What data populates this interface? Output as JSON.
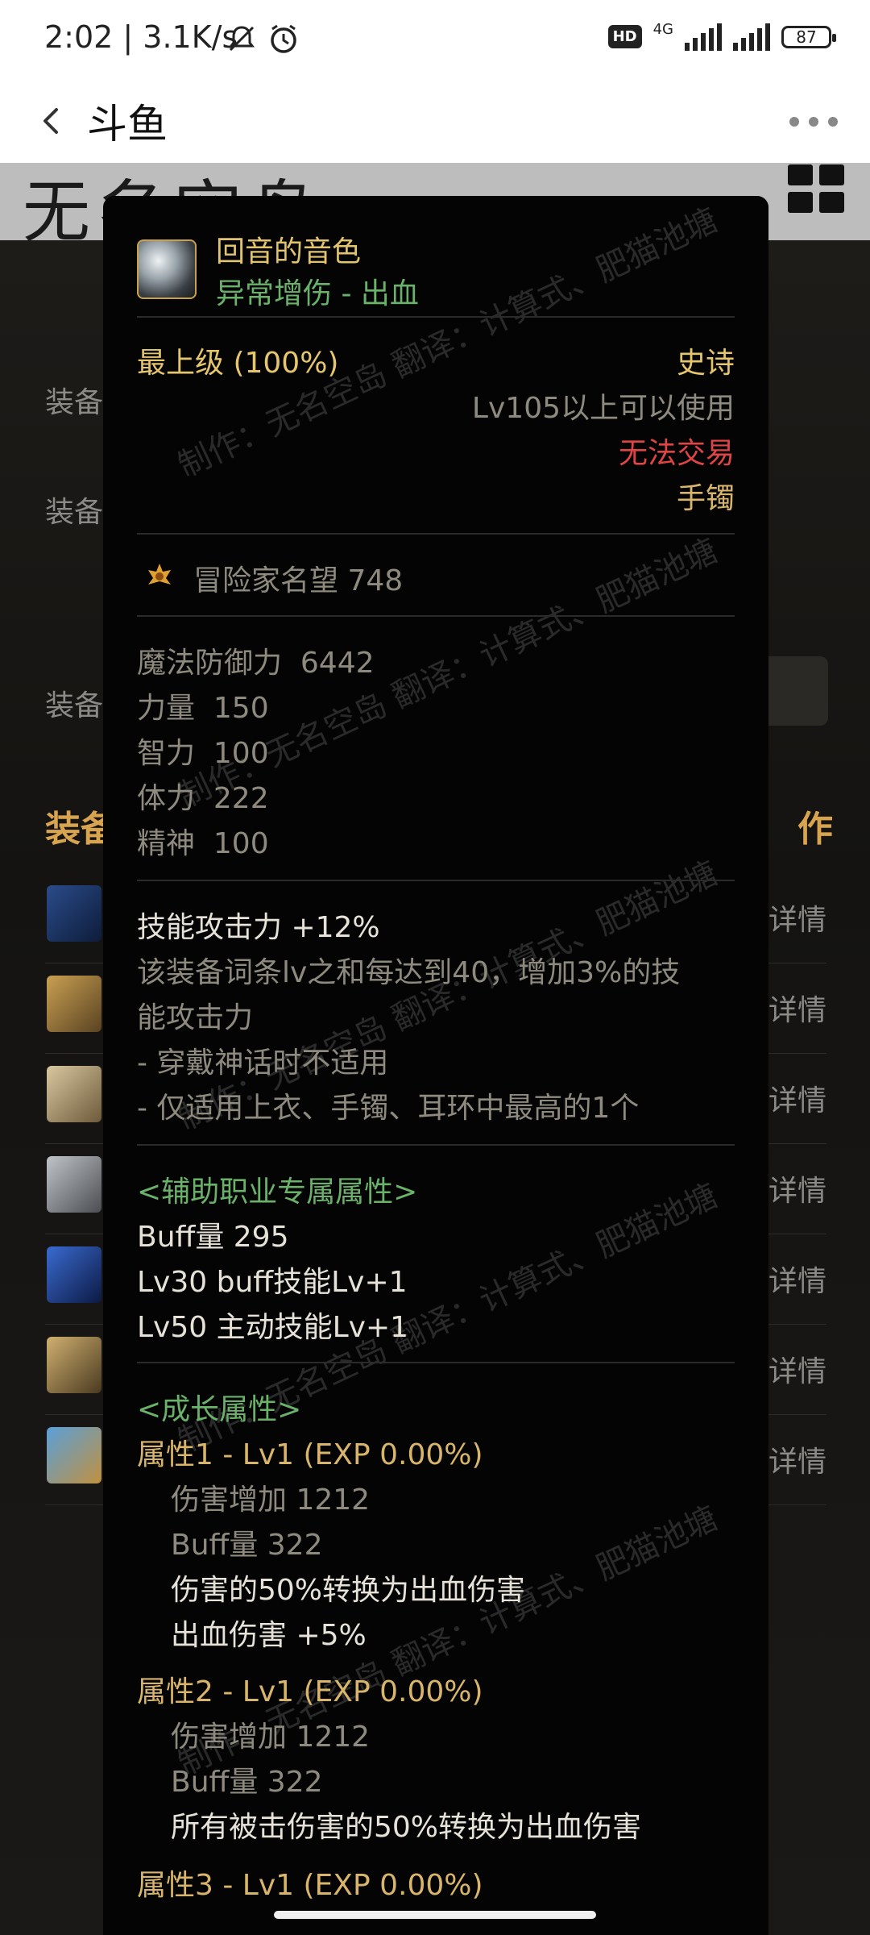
{
  "status_bar": {
    "time": "2:02 | 3.1K/s",
    "hd": "HD",
    "network": "4G",
    "battery": "87"
  },
  "app_bar": {
    "title": "斗鱼"
  },
  "background": {
    "banner_text": "无名空岛",
    "labels": [
      "装备",
      "装备",
      "装备"
    ],
    "heading": "装备",
    "heading_right": "作",
    "row_detail": "详情"
  },
  "tooltip": {
    "name": "回音的音色",
    "subtitle": "异常增伤 - 出血",
    "grade": "最上级 (100%)",
    "rarity": "史诗",
    "level_req": "Lv105以上可以使用",
    "trade": "无法交易",
    "slot": "手镯",
    "fame": "冒险家名望 748",
    "stats": [
      {
        "label": "魔法防御力",
        "value": "6442"
      },
      {
        "label": "力量",
        "value": "150"
      },
      {
        "label": "智力",
        "value": "100"
      },
      {
        "label": "体力",
        "value": "222"
      },
      {
        "label": "精神",
        "value": "100"
      }
    ],
    "skill_atk": "技能攻击力  +12%",
    "skill_desc_1": "该装备词条lv之和每达到40，增加3%的技",
    "skill_desc_2": "能攻击力",
    "skill_note_1": "- 穿戴神话时不适用",
    "skill_note_2": "- 仅适用上衣、手镯、耳环中最高的1个",
    "support_header": "<辅助职业专属属性>",
    "support_lines": [
      "Buff量  295",
      "Lv30 buff技能Lv+1",
      "Lv50 主动技能Lv+1"
    ],
    "growth_header": "<成长属性>",
    "attr1_title": "属性1 - Lv1 (EXP 0.00%)",
    "attr1_stat1": "伤害增加  1212",
    "attr1_stat2": "Buff量  322",
    "attr1_eff1": "伤害的50%转换为出血伤害",
    "attr1_eff2": "出血伤害 +5%",
    "attr2_title": "属性2 - Lv1 (EXP 0.00%)",
    "attr2_stat1": "伤害增加  1212",
    "attr2_stat2": "Buff量  322",
    "attr2_eff1": "所有被击伤害的50%转换为出血伤害",
    "attr3_title": "属性3 - Lv1 (EXP 0.00%)",
    "watermark": "制作：无名空岛 翻译：计算式、肥猫池塘"
  }
}
